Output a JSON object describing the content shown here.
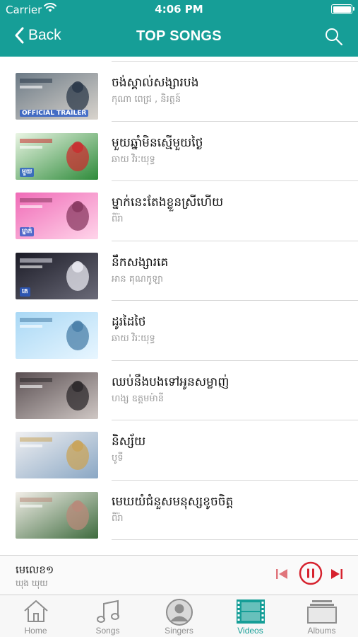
{
  "status_bar": {
    "carrier": "Carrier",
    "time": "4:06 PM",
    "wifi_icon": "wifi-icon",
    "battery_level": 1.0
  },
  "nav": {
    "back_label": "Back",
    "title": "TOP SONGS",
    "search_icon": "search-icon"
  },
  "songs": [
    {
      "title": "ចង់ស្គាល់សង្សារបង",
      "artist": "កុណា ពេជ្រ , និរត្តន៍",
      "thumb_colors": [
        "#6c7a86",
        "#d9d4cd",
        "#2c3a4a"
      ],
      "thumb_label": "OFFICIAL TRAILER"
    },
    {
      "title": "មួយឆ្នាំមិនស្មើមួយថ្ងៃ",
      "artist": "ឆាយ វិរៈយុទ្ធ",
      "thumb_colors": [
        "#eaf5e4",
        "#2e8b3a",
        "#c83030"
      ],
      "thumb_label": "មួយ"
    },
    {
      "title": "ម្នាក់នេះតែងខ្លួនស្រីហើយ",
      "artist": "ពីរ៉ា",
      "thumb_colors": [
        "#f06bb7",
        "#ffd5ea",
        "#8a3a62"
      ],
      "thumb_label": "ម្នាក់"
    },
    {
      "title": "នឹកសង្សារគេ",
      "artist": "អាន គុណកូឡា",
      "thumb_colors": [
        "#1b1b26",
        "#6a6a78",
        "#e8e8f0"
      ],
      "thumb_label": "គេ"
    },
    {
      "title": "ដូរដៃថៃ",
      "artist": "ឆាយ វិរៈយុទ្ធ",
      "thumb_colors": [
        "#a9d8f5",
        "#e8f6ff",
        "#4a7fa8"
      ],
      "thumb_label": ""
    },
    {
      "title": "ឈប់នឹងបងទៅអូនសម្លាញ់",
      "artist": "ហង្ស ឧត្តមម៉ានី",
      "thumb_colors": [
        "#5a4f52",
        "#cfc7c4",
        "#2e2a2c"
      ],
      "thumb_label": ""
    },
    {
      "title": "និស្ស័យ",
      "artist": "បូទី",
      "thumb_colors": [
        "#f0f0f2",
        "#8aa7c4",
        "#c9a45a"
      ],
      "thumb_label": ""
    },
    {
      "title": "មេឃយំជំនួសមនុស្សខូចចិត្ត",
      "artist": "ពីរ៉ា",
      "thumb_colors": [
        "#f3efe9",
        "#3e6b3e",
        "#b88a7a"
      ],
      "thumb_label": ""
    }
  ],
  "player": {
    "title": "មេលេខ១",
    "artist": "ឃុង ឃុយ",
    "accent_color": "#d6222e"
  },
  "tabs": [
    {
      "label": "Home",
      "icon": "home-icon",
      "active": false
    },
    {
      "label": "Songs",
      "icon": "music-note-icon",
      "active": false
    },
    {
      "label": "Singers",
      "icon": "singer-avatar-icon",
      "active": false
    },
    {
      "label": "Videos",
      "icon": "film-strip-icon",
      "active": true
    },
    {
      "label": "Albums",
      "icon": "albums-stack-icon",
      "active": false
    }
  ],
  "theme": {
    "primary": "#169e97",
    "separator": "#d8d8d8"
  }
}
